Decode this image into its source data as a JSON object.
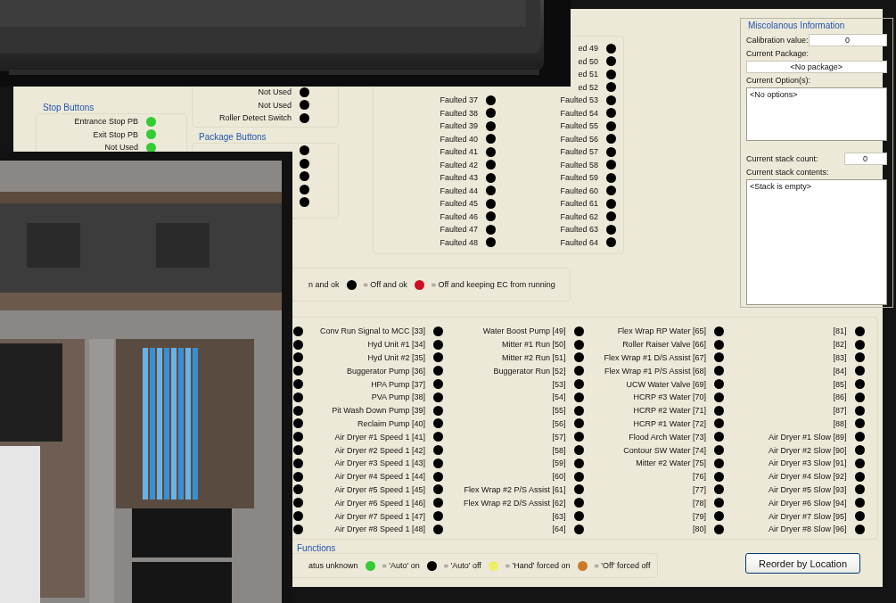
{
  "stop_buttons": {
    "title": "Stop Buttons",
    "items": [
      {
        "label": "Entrance Stop PB",
        "color": "#33cc33"
      },
      {
        "label": "Exit Stop PB",
        "color": "#33cc33"
      },
      {
        "label": "Not Used",
        "color": "#33cc33"
      }
    ]
  },
  "switches": {
    "items": [
      {
        "label": "Not Used",
        "color": "#000000"
      },
      {
        "label": "Not Used",
        "color": "#000000"
      },
      {
        "label": "Roller Detect Switch",
        "color": "#000000"
      }
    ]
  },
  "package_buttons": {
    "title": "Package Buttons",
    "items": [
      {
        "color": "#000000"
      },
      {
        "color": "#000000"
      },
      {
        "color": "#000000"
      },
      {
        "color": "#000000"
      },
      {
        "color": "#000000"
      }
    ]
  },
  "faults": {
    "column_1": [
      {
        "label": "Faulted 37",
        "color": "#000000"
      },
      {
        "label": "Faulted 38",
        "color": "#000000"
      },
      {
        "label": "Faulted 39",
        "color": "#000000"
      },
      {
        "label": "Faulted 40",
        "color": "#000000"
      },
      {
        "label": "Faulted 41",
        "color": "#000000"
      },
      {
        "label": "Faulted 42",
        "color": "#000000"
      },
      {
        "label": "Faulted 43",
        "color": "#000000"
      },
      {
        "label": "Faulted 44",
        "color": "#000000"
      },
      {
        "label": "Faulted 45",
        "color": "#000000"
      },
      {
        "label": "Faulted 46",
        "color": "#000000"
      },
      {
        "label": "Faulted 47",
        "color": "#000000"
      },
      {
        "label": "Faulted 48",
        "color": "#000000"
      }
    ],
    "column_2": [
      {
        "label": "ed 49",
        "color": "#000000"
      },
      {
        "label": "ed 50",
        "color": "#000000"
      },
      {
        "label": "ed 51",
        "color": "#000000"
      },
      {
        "label": "ed 52",
        "color": "#000000"
      },
      {
        "label": "Faulted 53",
        "color": "#000000"
      },
      {
        "label": "Faulted 54",
        "color": "#000000"
      },
      {
        "label": "Faulted 55",
        "color": "#000000"
      },
      {
        "label": "Faulted 56",
        "color": "#000000"
      },
      {
        "label": "Faulted 57",
        "color": "#000000"
      },
      {
        "label": "Faulted 58",
        "color": "#000000"
      },
      {
        "label": "Faulted 59",
        "color": "#000000"
      },
      {
        "label": "Faulted 60",
        "color": "#000000"
      },
      {
        "label": "Faulted 61",
        "color": "#000000"
      },
      {
        "label": "Faulted 62",
        "color": "#000000"
      },
      {
        "label": "Faulted 63",
        "color": "#000000"
      },
      {
        "label": "Faulted 64",
        "color": "#000000"
      }
    ]
  },
  "status_legend": [
    {
      "text": "n and ok"
    },
    {
      "color": "#000000",
      "text": "= Off and ok"
    },
    {
      "color": "#cc1122",
      "text": "= Off and keeping EC from running"
    }
  ],
  "misc": {
    "title": "Miscolanous Information",
    "calibration_label": "Calibration value:",
    "calibration_value": "0",
    "package_label": "Current Package:",
    "package_value": "<No package>",
    "options_label": "Current Option(s):",
    "options_value": "<No options>",
    "stack_count_label": "Current stack count:",
    "stack_count_value": "0",
    "stack_contents_label": "Current stack contents:",
    "stack_contents_value": "<Stack is empty>"
  },
  "outputs": {
    "columns": [
      [
        {
          "color": "#000000"
        },
        {
          "color": "#000000"
        },
        {
          "color": "#000000"
        },
        {
          "color": "#000000"
        },
        {
          "color": "#000000"
        },
        {
          "color": "#000000"
        },
        {
          "color": "#000000"
        },
        {
          "color": "#000000"
        },
        {
          "color": "#000000"
        },
        {
          "color": "#000000"
        },
        {
          "color": "#000000"
        },
        {
          "color": "#000000"
        },
        {
          "color": "#000000"
        },
        {
          "color": "#000000"
        },
        {
          "color": "#000000"
        },
        {
          "color": "#000000"
        }
      ],
      [
        {
          "label": "Conv Run Signal to MCC [33]",
          "color": "#000000"
        },
        {
          "label": "Hyd Unit #1 [34]",
          "color": "#000000"
        },
        {
          "label": "Hyd Unit #2 [35]",
          "color": "#000000"
        },
        {
          "label": "Buggerator Pump [36]",
          "color": "#000000"
        },
        {
          "label": "HPA Pump [37]",
          "color": "#000000"
        },
        {
          "label": "PVA Pump [38]",
          "color": "#000000"
        },
        {
          "label": "Pit Wash Down Pump [39]",
          "color": "#000000"
        },
        {
          "label": "Reclaim Pump [40]",
          "color": "#000000"
        },
        {
          "label": "Air Dryer #1 Speed 1 [41]",
          "color": "#000000"
        },
        {
          "label": "Air Dryer #2 Speed 1 [42]",
          "color": "#000000"
        },
        {
          "label": "Air Dryer #3 Speed 1 [43]",
          "color": "#000000"
        },
        {
          "label": "Air Dryer #4 Speed 1 [44]",
          "color": "#000000"
        },
        {
          "label": "Air Dryer #5 Speed 1 [45]",
          "color": "#000000"
        },
        {
          "label": "Air Dryer #6 Speed 1 [46]",
          "color": "#000000"
        },
        {
          "label": "Air Dryer #7 Speed 1 [47]",
          "color": "#000000"
        },
        {
          "label": "Air Dryer #8 Speed 1 [48]",
          "color": "#000000"
        }
      ],
      [
        {
          "label": "Water Boost Pump [49]",
          "color": "#000000"
        },
        {
          "label": "Mitter #1 Run [50]",
          "color": "#000000"
        },
        {
          "label": "Mitter #2 Run [51]",
          "color": "#000000"
        },
        {
          "label": "Buggerator Run [52]",
          "color": "#000000"
        },
        {
          "label": "[53]",
          "color": "#000000"
        },
        {
          "label": "[54]",
          "color": "#000000"
        },
        {
          "label": "[55]",
          "color": "#000000"
        },
        {
          "label": "[56]",
          "color": "#000000"
        },
        {
          "label": "[57]",
          "color": "#000000"
        },
        {
          "label": "[58]",
          "color": "#000000"
        },
        {
          "label": "[59]",
          "color": "#000000"
        },
        {
          "label": "[60]",
          "color": "#000000"
        },
        {
          "label": "Flex Wrap #2 P/S Assist [61]",
          "color": "#000000"
        },
        {
          "label": "Flex Wrap #2 D/S Assist [62]",
          "color": "#000000"
        },
        {
          "label": "[63]",
          "color": "#000000"
        },
        {
          "label": "[64]",
          "color": "#000000"
        }
      ],
      [
        {
          "label": "Flex Wrap RP Water [65]",
          "color": "#000000"
        },
        {
          "label": "Roller Raiser Valve [66]",
          "color": "#000000"
        },
        {
          "label": "Flex Wrap #1 D/S Assist [67]",
          "color": "#000000"
        },
        {
          "label": "Flex Wrap #1 P/S Assist [68]",
          "color": "#000000"
        },
        {
          "label": "UCW Water Valve [69]",
          "color": "#000000"
        },
        {
          "label": "HCRP #3 Water [70]",
          "color": "#000000"
        },
        {
          "label": "HCRP #2 Water [71]",
          "color": "#000000"
        },
        {
          "label": "HCRP #1 Water [72]",
          "color": "#000000"
        },
        {
          "label": "Flood Arch Water [73]",
          "color": "#000000"
        },
        {
          "label": "Contour SW Water [74]",
          "color": "#000000"
        },
        {
          "label": "Mitter #2 Water [75]",
          "color": "#000000"
        },
        {
          "label": "[76]",
          "color": "#000000"
        },
        {
          "label": "[77]",
          "color": "#000000"
        },
        {
          "label": "[78]",
          "color": "#000000"
        },
        {
          "label": "[79]",
          "color": "#000000"
        },
        {
          "label": "[80]",
          "color": "#000000"
        }
      ],
      [
        {
          "label": "[81]",
          "color": "#000000"
        },
        {
          "label": "[82]",
          "color": "#000000"
        },
        {
          "label": "[83]",
          "color": "#000000"
        },
        {
          "label": "[84]",
          "color": "#000000"
        },
        {
          "label": "[85]",
          "color": "#000000"
        },
        {
          "label": "[86]",
          "color": "#000000"
        },
        {
          "label": "[87]",
          "color": "#000000"
        },
        {
          "label": "[88]",
          "color": "#000000"
        },
        {
          "label": "Air Dryer #1 Slow [89]",
          "color": "#000000"
        },
        {
          "label": "Air Dryer #2 Slow [90]",
          "color": "#000000"
        },
        {
          "label": "Air Dryer #3 Slow [91]",
          "color": "#000000"
        },
        {
          "label": "Air Dryer #4 Slow [92]",
          "color": "#000000"
        },
        {
          "label": "Air Dryer #5 Slow [93]",
          "color": "#000000"
        },
        {
          "label": "Air Dryer #6 Slow [94]",
          "color": "#000000"
        },
        {
          "label": "Air Dryer #7 Slow [95]",
          "color": "#000000"
        },
        {
          "label": "Air Dryer #8 Slow [96]",
          "color": "#000000"
        }
      ]
    ]
  },
  "functions": {
    "title": "Functions",
    "legend": [
      {
        "text": "atus unknown"
      },
      {
        "color": "#33cc33",
        "text": "= 'Auto' on"
      },
      {
        "color": "#000000",
        "text": "= 'Auto' off"
      },
      {
        "color": "#eeee66",
        "text": "= 'Hand' forced on"
      },
      {
        "color": "#cc7a2a",
        "text": "= 'Off' forced off"
      }
    ]
  },
  "reorder_button": "Reorder by Location"
}
